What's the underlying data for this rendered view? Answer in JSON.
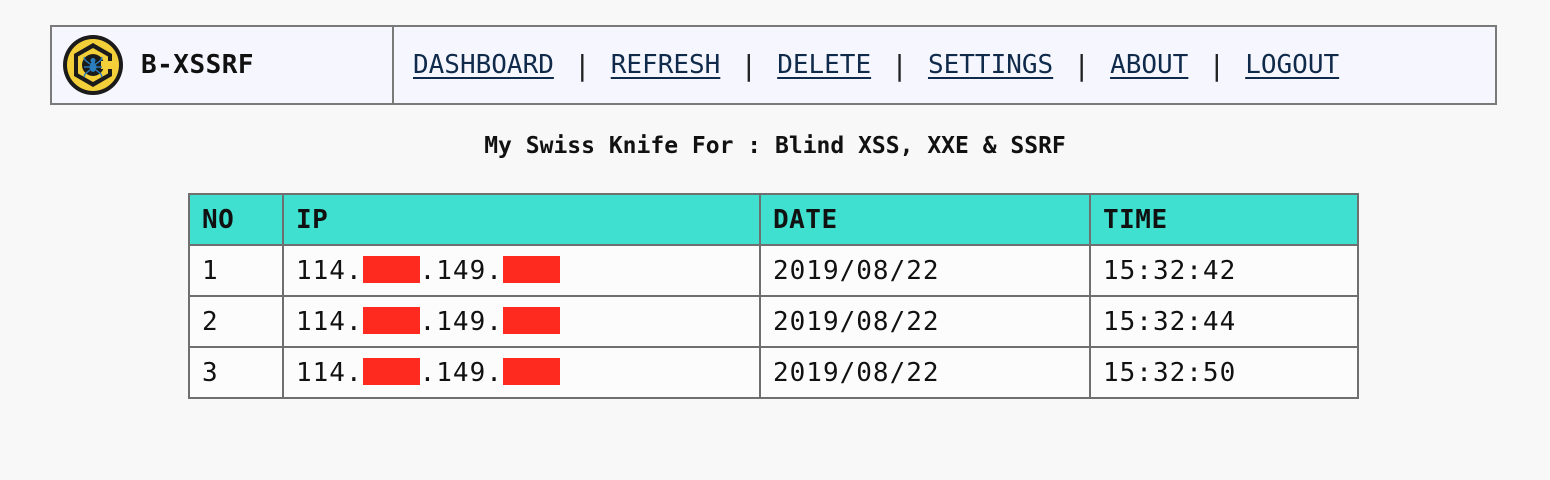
{
  "brand": {
    "name": "B-XSSRF",
    "logo_icon": "spider-hex-logo",
    "logo_colors": {
      "ring": "#f3cf3a",
      "outline": "#1b1b1b",
      "spider": "#2b7fbf"
    }
  },
  "nav": {
    "items": [
      {
        "label": "DASHBOARD"
      },
      {
        "label": "REFRESH"
      },
      {
        "label": "DELETE"
      },
      {
        "label": "SETTINGS"
      },
      {
        "label": "ABOUT"
      },
      {
        "label": "LOGOUT"
      }
    ],
    "separator": "|"
  },
  "subtitle": "My Swiss Knife For : Blind XSS, XXE & SSRF",
  "table": {
    "header_color": "#40e0d0",
    "redaction_color": "#ff2a1f",
    "columns": [
      "NO",
      "IP",
      "DATE",
      "TIME"
    ],
    "rows": [
      {
        "no": "1",
        "ip_part1": "114.",
        "ip_part2": ".149.",
        "date": "2019/08/22",
        "time": "15:32:42"
      },
      {
        "no": "2",
        "ip_part1": "114.",
        "ip_part2": ".149.",
        "date": "2019/08/22",
        "time": "15:32:44"
      },
      {
        "no": "3",
        "ip_part1": "114.",
        "ip_part2": ".149.",
        "date": "2019/08/22",
        "time": "15:32:50"
      }
    ]
  }
}
